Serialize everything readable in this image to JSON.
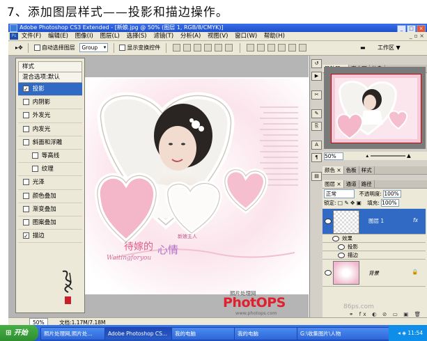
{
  "step_heading": "7、添加图层样式——投影和描边操作。",
  "app": {
    "title": "Adobe Photoshop CS3 Extended - [新娘.jpg @ 50% (图层 1, RGB/8/CMYK)]",
    "menu": [
      "文件(F)",
      "编辑(E)",
      "图像(I)",
      "图层(L)",
      "选择(S)",
      "滤镜(T)",
      "分析(A)",
      "视图(V)",
      "窗口(W)",
      "帮助(H)"
    ],
    "options": {
      "auto_select_label": "自动选择图层",
      "group_value": "Group",
      "show_transform_label": "显示变换控件",
      "workspace_label": "工作区 ▼"
    }
  },
  "layer_style": {
    "title": "样式",
    "blend": "混合选项:默认",
    "items": [
      {
        "label": "投影",
        "checked": true,
        "selected": true
      },
      {
        "label": "内阴影",
        "checked": false
      },
      {
        "label": "外发光",
        "checked": false
      },
      {
        "label": "内发光",
        "checked": false
      },
      {
        "label": "斜面和浮雕",
        "checked": false
      },
      {
        "label": "等高线",
        "checked": false,
        "sub": true
      },
      {
        "label": "纹理",
        "checked": false,
        "sub": true
      },
      {
        "label": "光泽",
        "checked": false
      },
      {
        "label": "颜色叠加",
        "checked": false
      },
      {
        "label": "渐变叠加",
        "checked": false
      },
      {
        "label": "图案叠加",
        "checked": false
      },
      {
        "label": "描边",
        "checked": true
      }
    ]
  },
  "canvas_text": {
    "bride_pink": "待嫁的",
    "heart_word": "心情",
    "small_italic": "Waitingforyou",
    "side_caption": "新娘主人",
    "watermark_top": "照片处理网",
    "watermark_logo": "PhotOPS",
    "watermark_url": "www.photops.com"
  },
  "navigator": {
    "tabs": [
      "导航器 ×",
      "直方图",
      "信息"
    ],
    "zoom": "50%"
  },
  "panels": {
    "color_tabs": [
      "颜色 ×",
      "色板",
      "样式"
    ],
    "layer_tabs": [
      "图层 ×",
      "通道",
      "路径"
    ],
    "blend_mode": "正常",
    "opacity_label": "不透明度:",
    "opacity": "100%",
    "lock_label": "锁定:",
    "fill_label": "填充:",
    "fill": "100%",
    "layer1_name": "图层 1",
    "fx": "fx",
    "effects_label": "效果",
    "effect_dropshadow": "投影",
    "effect_stroke": "描边",
    "bg_name": "背景",
    "site_watermark": "86ps.com"
  },
  "status": {
    "zoom": "50%",
    "doc": "文档:1.17M/7.18M"
  },
  "taskbar": {
    "start_label": "开始",
    "items": [
      "照片处理网,照片处...",
      "Adobe Photoshop CS...",
      "我的电脑",
      "我的电脑",
      "G:\\收集图片\\人物"
    ],
    "clock": "11:54"
  },
  "colors": {
    "selection_blue": "#316ac5",
    "layer_pink": "#f0b8cc",
    "logo_red": "#e0202e",
    "logo_purple": "#5a2a8c"
  }
}
